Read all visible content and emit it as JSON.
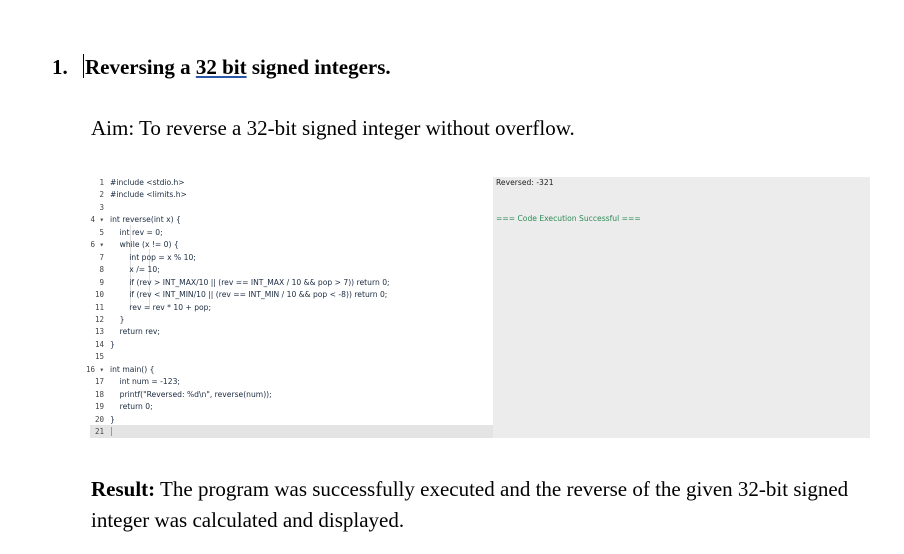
{
  "heading": {
    "number": "1.",
    "part1": "Reversing a ",
    "part2": "32 bit",
    "part3": " signed integers."
  },
  "aim": "Aim: To reverse a 32-bit signed integer without overflow.",
  "editor": {
    "line_numbers": [
      "1",
      "2",
      "3",
      "4 ▾",
      "5",
      "6 ▾",
      "7",
      "8",
      "9",
      "10",
      "11",
      "12",
      "13",
      "14",
      "15",
      "16 ▾",
      "17",
      "18",
      "19",
      "20",
      "21"
    ],
    "lines": [
      "#include <stdio.h>",
      "#include <limits.h>",
      "",
      "int reverse(int x) {",
      "    int rev = 0;",
      "    while (x != 0) {",
      "        int pop = x % 10;",
      "        x /= 10;",
      "        if (rev > INT_MAX/10 || (rev == INT_MAX / 10 && pop > 7)) return 0;",
      "        if (rev < INT_MIN/10 || (rev == INT_MIN / 10 && pop < -8)) return 0;",
      "        rev = rev * 10 + pop;",
      "    }",
      "    return rev;",
      "}",
      "",
      "int main() {",
      "    int num = -123;",
      "    printf(\"Reversed: %d\\n\", reverse(num));",
      "    return 0;",
      "}",
      ""
    ]
  },
  "output": {
    "line1": "Reversed: -321",
    "status": "=== Code Execution Successful ==="
  },
  "result": {
    "label": "Result:",
    "text": " The program was successfully executed and the reverse of the given 32-bit signed integer was calculated and displayed."
  }
}
